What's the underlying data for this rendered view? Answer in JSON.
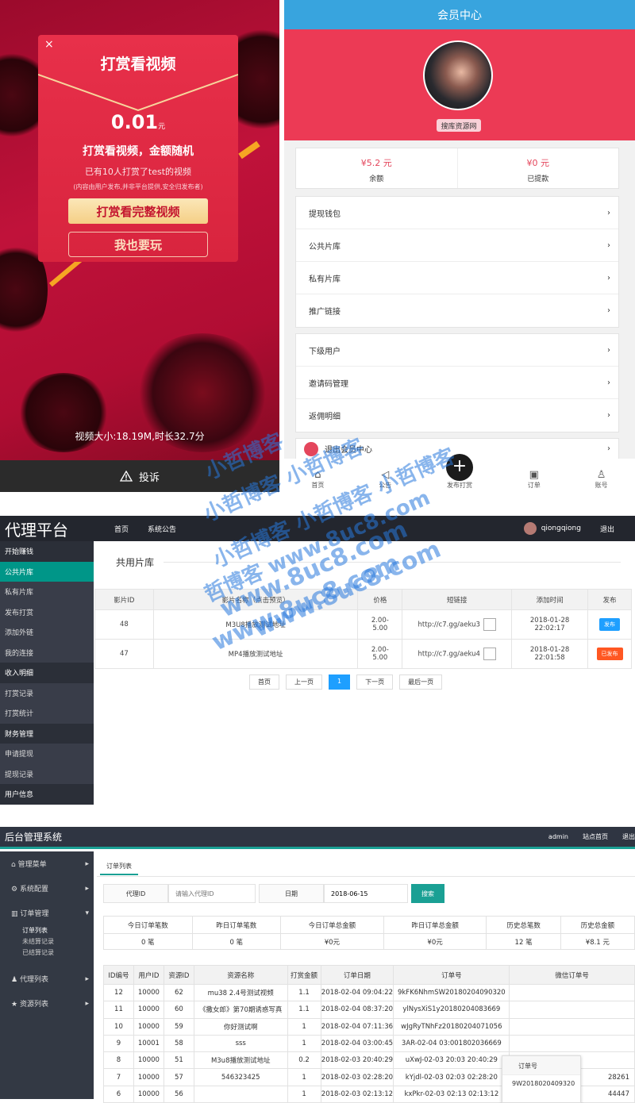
{
  "p1": {
    "title": "打赏看视频",
    "amount": "0.01",
    "unit": "元",
    "line1": "打赏看视频，金额随机",
    "line2": "已有10人打赏了test的视频",
    "line3": "(内容由用户发布,并非平台提供,安全归发布者)",
    "btn_watch": "打赏看完整视频",
    "btn_play": "我也要玩",
    "video_info": "视频大小:18.19M,时长32.7分",
    "report": "投诉",
    "close": "×"
  },
  "p2": {
    "header": "会员中心",
    "avatar_label": "搜库资源网",
    "balance": "¥5.2 元",
    "balance_label": "余额",
    "withdrawn": "¥0 元",
    "withdrawn_label": "已提款",
    "group1": [
      "提现钱包",
      "公共片库",
      "私有片库",
      "推广链接"
    ],
    "group2": [
      "下级用户",
      "邀请码管理",
      "返佣明细"
    ],
    "logout": "退出会员中心",
    "tabs": [
      "首页",
      "公告",
      "发布打赏",
      "订单",
      "账号"
    ]
  },
  "p3": {
    "brand": "代理平台",
    "nav": [
      "首页",
      "系统公告"
    ],
    "user": "qiongqiong",
    "logout": "退出",
    "side": [
      {
        "t": "开始赚钱",
        "h": true
      },
      {
        "t": "公共片库",
        "a": true
      },
      {
        "t": "私有片库"
      },
      {
        "t": "发布打赏"
      },
      {
        "t": "添加外链"
      },
      {
        "t": "我的连接"
      },
      {
        "t": "收入明细",
        "h": true
      },
      {
        "t": "打赏记录"
      },
      {
        "t": "打赏统计"
      },
      {
        "t": "财务管理",
        "h": true
      },
      {
        "t": "申请提现"
      },
      {
        "t": "提现记录"
      },
      {
        "t": "用户信息",
        "h": true
      }
    ],
    "section": "共用片库",
    "cols": [
      "影片ID",
      "影片名称（点击预览）",
      "价格",
      "短链接",
      "添加时间",
      "发布"
    ],
    "rows": [
      {
        "id": "48",
        "name": "M3U8播放测试地址",
        "price": "2.00-\n5.00",
        "link": "http://c7.gg/aeku3",
        "time": "2018-01-28\n22:02:17",
        "btn": "发布"
      },
      {
        "id": "47",
        "name": "MP4播放测试地址",
        "price": "2.00-\n5.00",
        "link": "http://c7.gg/aeku4",
        "time": "2018-01-28\n22:01:58",
        "btn": "已发布"
      }
    ],
    "pager": [
      "首页",
      "上一页",
      "1",
      "下一页",
      "最后一页"
    ]
  },
  "p4": {
    "brand": "后台管理系统",
    "nav": [
      "admin",
      "站点首页",
      "退出"
    ],
    "side": [
      "管理菜单",
      "系统配置",
      "订单管理",
      "代理列表",
      "资源列表"
    ],
    "sub": [
      "订单列表",
      "未结算记录",
      "已结算记录"
    ],
    "tab": "订单列表",
    "f_agent": "代理ID",
    "f_agent_ph": "请输入代理ID",
    "f_date": "日期",
    "f_date_val": "2018-06-15",
    "search": "搜索",
    "stats_h": [
      "今日订单笔数",
      "昨日订单笔数",
      "今日订单总金额",
      "昨日订单总金额",
      "历史总笔数",
      "历史总金额"
    ],
    "stats_v": [
      "0 笔",
      "0 笔",
      "¥0元",
      "¥0元",
      "12 笔",
      "¥8.1 元"
    ],
    "cols": [
      "ID编号",
      "用户ID",
      "资源ID",
      "资源名称",
      "打赏金额",
      "订单日期",
      "订单号",
      "微信订单号"
    ],
    "rows": [
      [
        "12",
        "10000",
        "62",
        "mu38 2.4号测试视频",
        "1.1",
        "2018-02-04 09:04:22",
        "9kFK6NhmSW20180204090320",
        ""
      ],
      [
        "11",
        "10000",
        "60",
        "《撒女郎》第70期诱惑写真",
        "1.1",
        "2018-02-04 08:37:20",
        "ylNysXiS1y20180204083669",
        ""
      ],
      [
        "10",
        "10000",
        "59",
        "你好测试啊",
        "1",
        "2018-02-04 07:11:36",
        "wJgRyTNhFz20180204071056",
        ""
      ],
      [
        "9",
        "10001",
        "58",
        "sss",
        "1",
        "2018-02-04 03:00:45",
        "3AR-02-04 03:001802036669",
        ""
      ],
      [
        "8",
        "10000",
        "51",
        "M3u8播放测试地址",
        "0.2",
        "2018-02-03 20:40:29",
        "uXwJ-02-03 20:03 20:40:29",
        ""
      ],
      [
        "7",
        "10000",
        "57",
        "546323425",
        "1",
        "2018-02-03 02:28:20",
        "kYjdl-02-03 02:03 02:28:20",
        "28261"
      ],
      [
        "6",
        "10000",
        "56",
        "",
        "1",
        "2018-02-03 02:13:12",
        "kxPkr-02-03 02:13 02:13:12",
        "44447"
      ]
    ],
    "popup_h": "订单号",
    "popup_v": "9W2018020409320"
  },
  "wm": [
    "小哲博客",
    "小哲博客 小哲博客",
    "小哲博客 小哲博客 小哲博客",
    "www.8uc8.com",
    "www.8uc8.com",
    "哲博客 www.8uc8.com",
    "www.8uc8.com"
  ]
}
